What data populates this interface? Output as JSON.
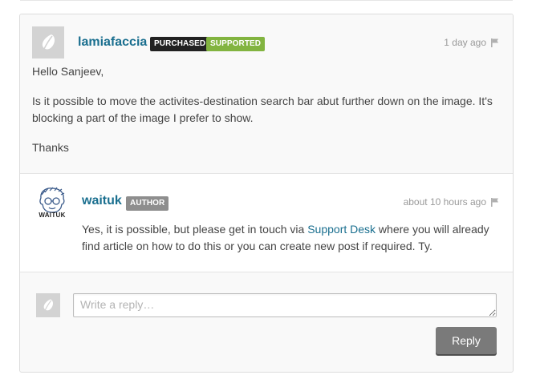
{
  "thread": {
    "comment": {
      "username": "lamiafaccia",
      "badges": [
        "PURCHASED",
        "SUPPORTED"
      ],
      "time": "1 day ago",
      "paragraphs": [
        "Hello Sanjeev,",
        "Is it possible to move the activites-destination search bar abut further down on the image. It's blocking a part of the image I prefer to show.",
        "Thanks"
      ]
    },
    "reply": {
      "username": "waituk",
      "badge": "AUTHOR",
      "avatar_text": "WAITUK",
      "time": "about 10 hours ago",
      "text_before": "Yes, it is possible, but please get in touch via ",
      "link_text": "Support Desk",
      "text_after": " where you will already find article on how to do this or you can create new post if required. Ty."
    },
    "form": {
      "placeholder": "Write a reply…",
      "button_label": "Reply"
    }
  },
  "colors": {
    "username": "#1a6f8f",
    "badge_purchased": "#222222",
    "badge_supported": "#82b440",
    "badge_author": "#8e8e8e",
    "button": "#7a7a7a"
  },
  "icons": [
    "envato-leaf-icon",
    "flag-icon",
    "waituk-avatar"
  ]
}
